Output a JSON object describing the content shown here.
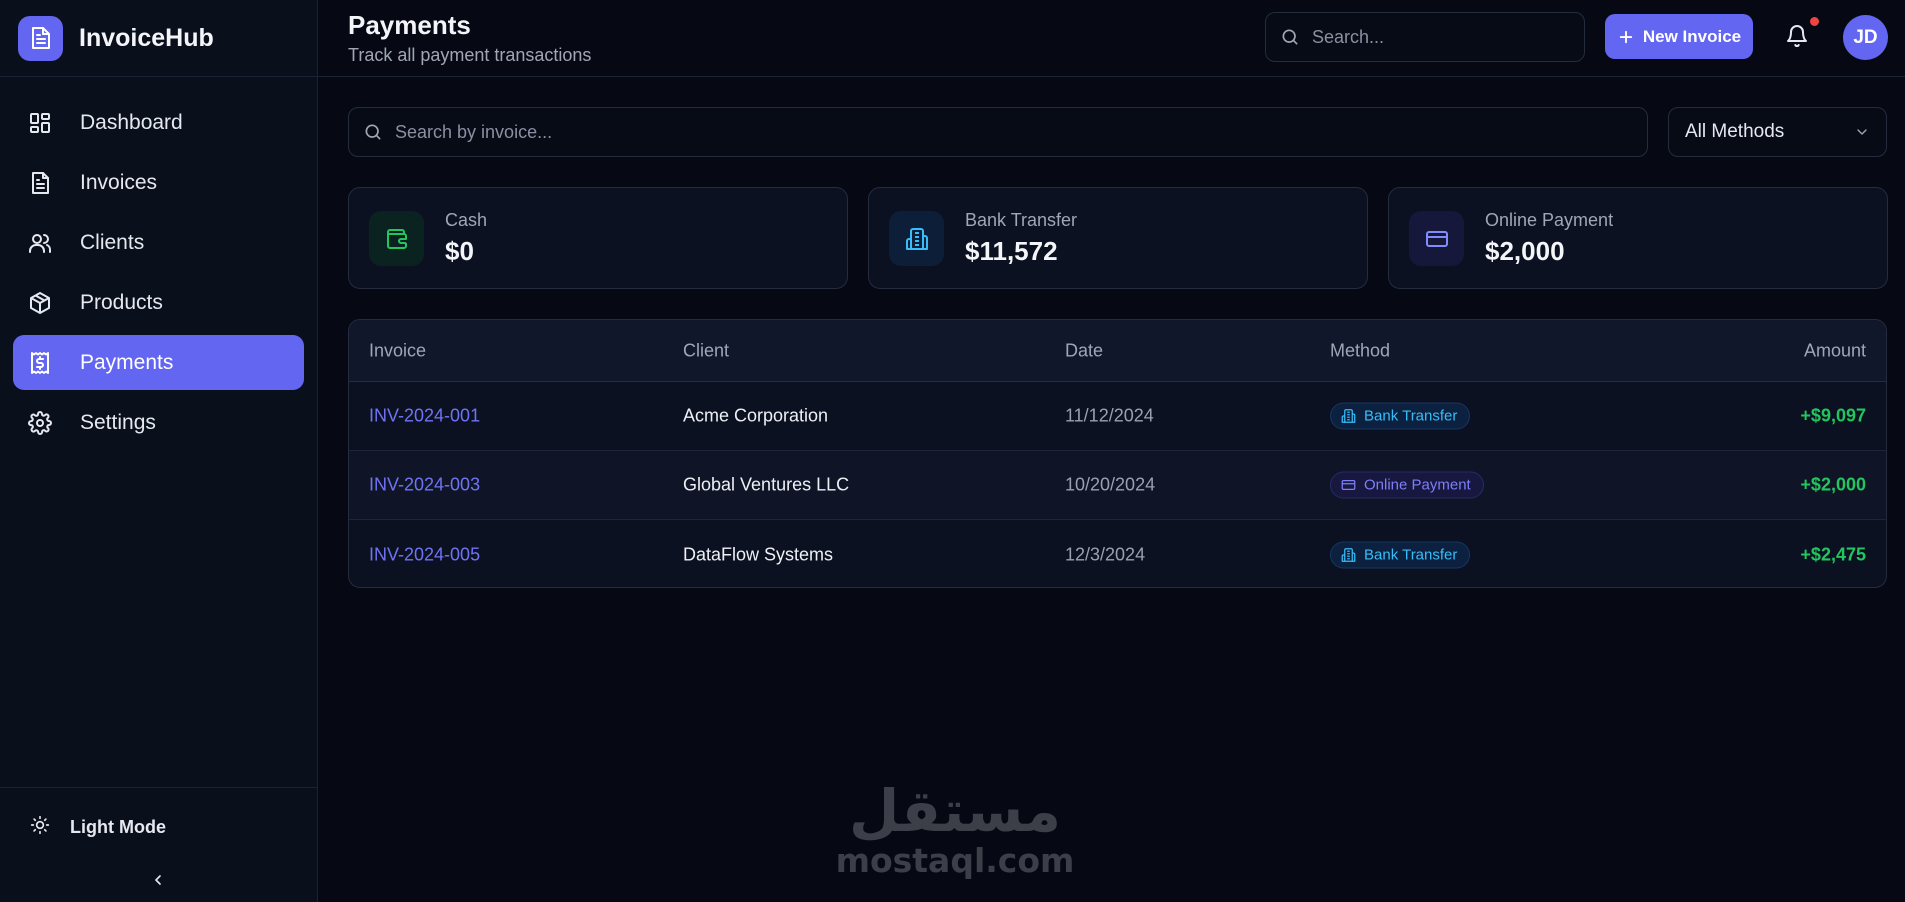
{
  "brand": {
    "name": "InvoiceHub"
  },
  "sidebar": {
    "items": [
      {
        "label": "Dashboard",
        "icon": "dashboard-icon"
      },
      {
        "label": "Invoices",
        "icon": "document-icon"
      },
      {
        "label": "Clients",
        "icon": "users-icon"
      },
      {
        "label": "Products",
        "icon": "box-icon"
      },
      {
        "label": "Payments",
        "icon": "receipt-icon",
        "active": true
      },
      {
        "label": "Settings",
        "icon": "gear-icon"
      }
    ],
    "theme_toggle": "Light Mode"
  },
  "header": {
    "title": "Payments",
    "subtitle": "Track all payment transactions",
    "search_placeholder": "Search...",
    "new_invoice_label": "New Invoice",
    "avatar_initials": "JD"
  },
  "filters": {
    "search_placeholder": "Search by invoice...",
    "method_selected": "All Methods"
  },
  "stats": [
    {
      "label": "Cash",
      "value": "$0",
      "icon": "wallet-icon",
      "color": "#22c55e"
    },
    {
      "label": "Bank Transfer",
      "value": "$11,572",
      "icon": "building-icon",
      "color": "#38bdf8"
    },
    {
      "label": "Online Payment",
      "value": "$2,000",
      "icon": "credit-card-icon",
      "color": "#818cf8"
    }
  ],
  "table": {
    "columns": [
      "Invoice",
      "Client",
      "Date",
      "Method",
      "Amount"
    ],
    "rows": [
      {
        "invoice": "INV-2024-001",
        "client": "Acme Corporation",
        "date": "11/12/2024",
        "method": "Bank Transfer",
        "amount": "+$9,097"
      },
      {
        "invoice": "INV-2024-003",
        "client": "Global Ventures LLC",
        "date": "10/20/2024",
        "method": "Online Payment",
        "amount": "+$2,000"
      },
      {
        "invoice": "INV-2024-005",
        "client": "DataFlow Systems",
        "date": "12/3/2024",
        "method": "Bank Transfer",
        "amount": "+$2,475"
      }
    ]
  },
  "watermark": {
    "arabic": "مستقل",
    "latin": "mostaql.com"
  },
  "colors": {
    "accent": "#6366f1",
    "positive": "#22c55e",
    "notification": "#ef4444"
  }
}
